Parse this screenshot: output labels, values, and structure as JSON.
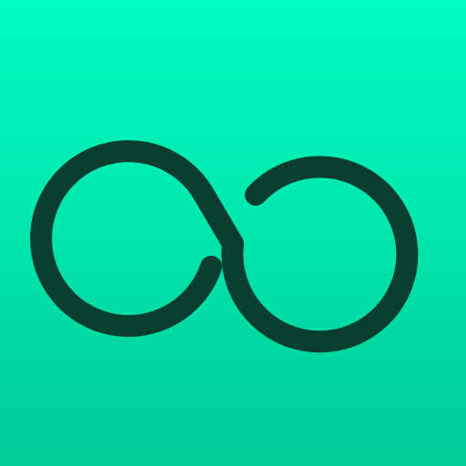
{
  "app_icon": {
    "icon": "infinity-icon",
    "colors": {
      "background_top": "#00FCC0",
      "background_mid": "#00E8AE",
      "background_bottom": "#00CB97",
      "symbol_stroke": "#073E30"
    }
  }
}
